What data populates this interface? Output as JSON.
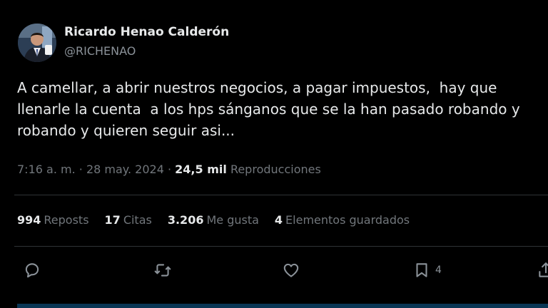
{
  "author": {
    "name": "Ricardo Henao Calderón",
    "handle": "@RICHENAO"
  },
  "tweet": {
    "text": "A camellar, a abrir nuestros negocios, a pagar impuestos,  hay que\nllenarle la cuenta  a los hps sánganos que se la han pasado robando y\nrobando y quieren seguir asi..."
  },
  "meta": {
    "time": "7:16 a. m.",
    "separator": "·",
    "date": "28 may. 2024",
    "views_count": "24,5 mil",
    "views_label": "Reproducciones"
  },
  "stats": [
    {
      "count": "994",
      "label": "Reposts"
    },
    {
      "count": "17",
      "label": "Citas"
    },
    {
      "count": "3.206",
      "label": "Me gusta"
    },
    {
      "count": "4",
      "label": "Elementos guardados"
    }
  ],
  "actions": {
    "reply_icon": "reply-icon",
    "repost_icon": "repost-icon",
    "like_icon": "heart-icon",
    "bookmark_icon": "bookmark-icon",
    "bookmark_count": "4",
    "share_icon": "share-icon"
  },
  "colors": {
    "background": "#000000",
    "text_primary": "#e7e9ea",
    "text_secondary": "#71767b",
    "divider": "#2f3336"
  }
}
